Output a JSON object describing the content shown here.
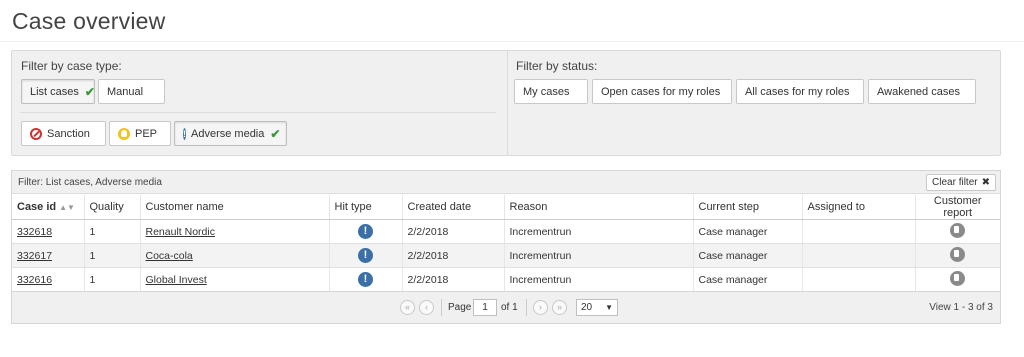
{
  "page": {
    "title": "Case overview"
  },
  "case_type_filter": {
    "heading": "Filter by case type:",
    "buttons": [
      {
        "label": "List cases",
        "active": true
      },
      {
        "label": "Manual",
        "active": false
      }
    ],
    "hit_buttons": [
      {
        "label": "Sanction",
        "icon": "sanction-icon",
        "active": false
      },
      {
        "label": "PEP",
        "icon": "pep-icon",
        "active": false
      },
      {
        "label": "Adverse media",
        "icon": "info-icon",
        "active": true
      }
    ]
  },
  "status_filter": {
    "heading": "Filter by status:",
    "buttons": [
      {
        "label": "My cases"
      },
      {
        "label": "Open cases for my roles"
      },
      {
        "label": "All cases for my roles"
      },
      {
        "label": "Awakened cases"
      }
    ]
  },
  "grid": {
    "filter_text": "Filter:  List cases, Adverse media",
    "clear_filter_label": "Clear filter",
    "columns": [
      "Case id",
      "Quality",
      "Customer name",
      "Hit type",
      "Created date",
      "Reason",
      "Current step",
      "Assigned to",
      "Customer report"
    ],
    "rows": [
      {
        "case_id": "332618",
        "quality": "1",
        "customer": "Renault Nordic",
        "hit_type": "adverse-media",
        "created": "2/2/2018",
        "reason": "Incrementrun",
        "step": "Case manager",
        "assigned": ""
      },
      {
        "case_id": "332617",
        "quality": "1",
        "customer": "Coca-cola",
        "hit_type": "adverse-media",
        "created": "2/2/2018",
        "reason": "Incrementrun",
        "step": "Case manager",
        "assigned": ""
      },
      {
        "case_id": "332616",
        "quality": "1",
        "customer": "Global Invest",
        "hit_type": "adverse-media",
        "created": "2/2/2018",
        "reason": "Incrementrun",
        "step": "Case manager",
        "assigned": ""
      }
    ]
  },
  "pager": {
    "page_label": "Page",
    "page_value": "1",
    "of_label": "of 1",
    "page_size": "20",
    "view_text": "View 1 - 3 of 3"
  },
  "colors": {
    "success": "#3a9a3a",
    "info": "#3b6fa8",
    "sanction": "#cc3333",
    "pep": "#f3c21a"
  }
}
